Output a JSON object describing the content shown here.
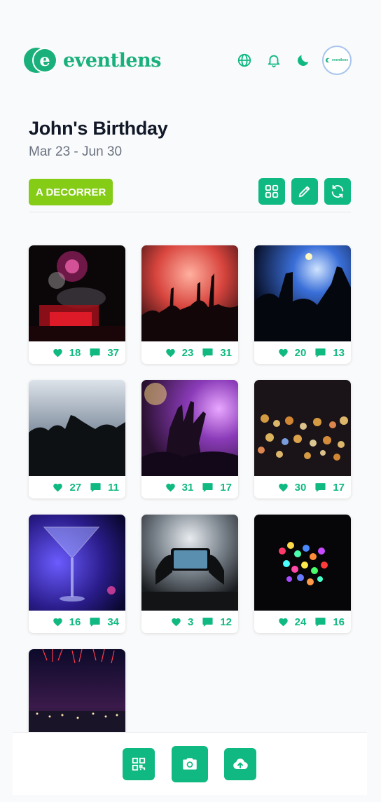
{
  "brand": {
    "name": "eventlens",
    "color": "#1ab07c"
  },
  "header": {
    "icons": [
      "globe-icon",
      "bell-icon",
      "moon-icon"
    ],
    "avatar_text": "eventlens"
  },
  "event": {
    "title": "John's Birthday",
    "dates": "Mar 23 - Jun 30",
    "status": "A DECORRER"
  },
  "toolbar": {
    "icons": [
      "grid-icon",
      "edit-icon",
      "refresh-icon"
    ]
  },
  "colors": {
    "accent": "#10b981",
    "status": "#84cc16",
    "title": "#111827",
    "muted": "#6b7280"
  },
  "photos": [
    {
      "scene": "fireworks-stage",
      "likes": "18",
      "comments": "37"
    },
    {
      "scene": "concert-red",
      "likes": "23",
      "comments": "31"
    },
    {
      "scene": "crowd-blue",
      "likes": "20",
      "comments": "13"
    },
    {
      "scene": "crowd-smoke",
      "likes": "27",
      "comments": "11"
    },
    {
      "scene": "hands-purple",
      "likes": "31",
      "comments": "17"
    },
    {
      "scene": "bokeh-city",
      "likes": "30",
      "comments": "17"
    },
    {
      "scene": "martini-glass",
      "likes": "16",
      "comments": "34"
    },
    {
      "scene": "phone-recording",
      "likes": "3",
      "comments": "12"
    },
    {
      "scene": "fairy-lights",
      "likes": "24",
      "comments": "16"
    },
    {
      "scene": "fireworks-city",
      "likes": "",
      "comments": ""
    }
  ],
  "bottom_bar": {
    "icons": [
      "qr-code-icon",
      "camera-icon",
      "cloud-upload-icon"
    ]
  }
}
